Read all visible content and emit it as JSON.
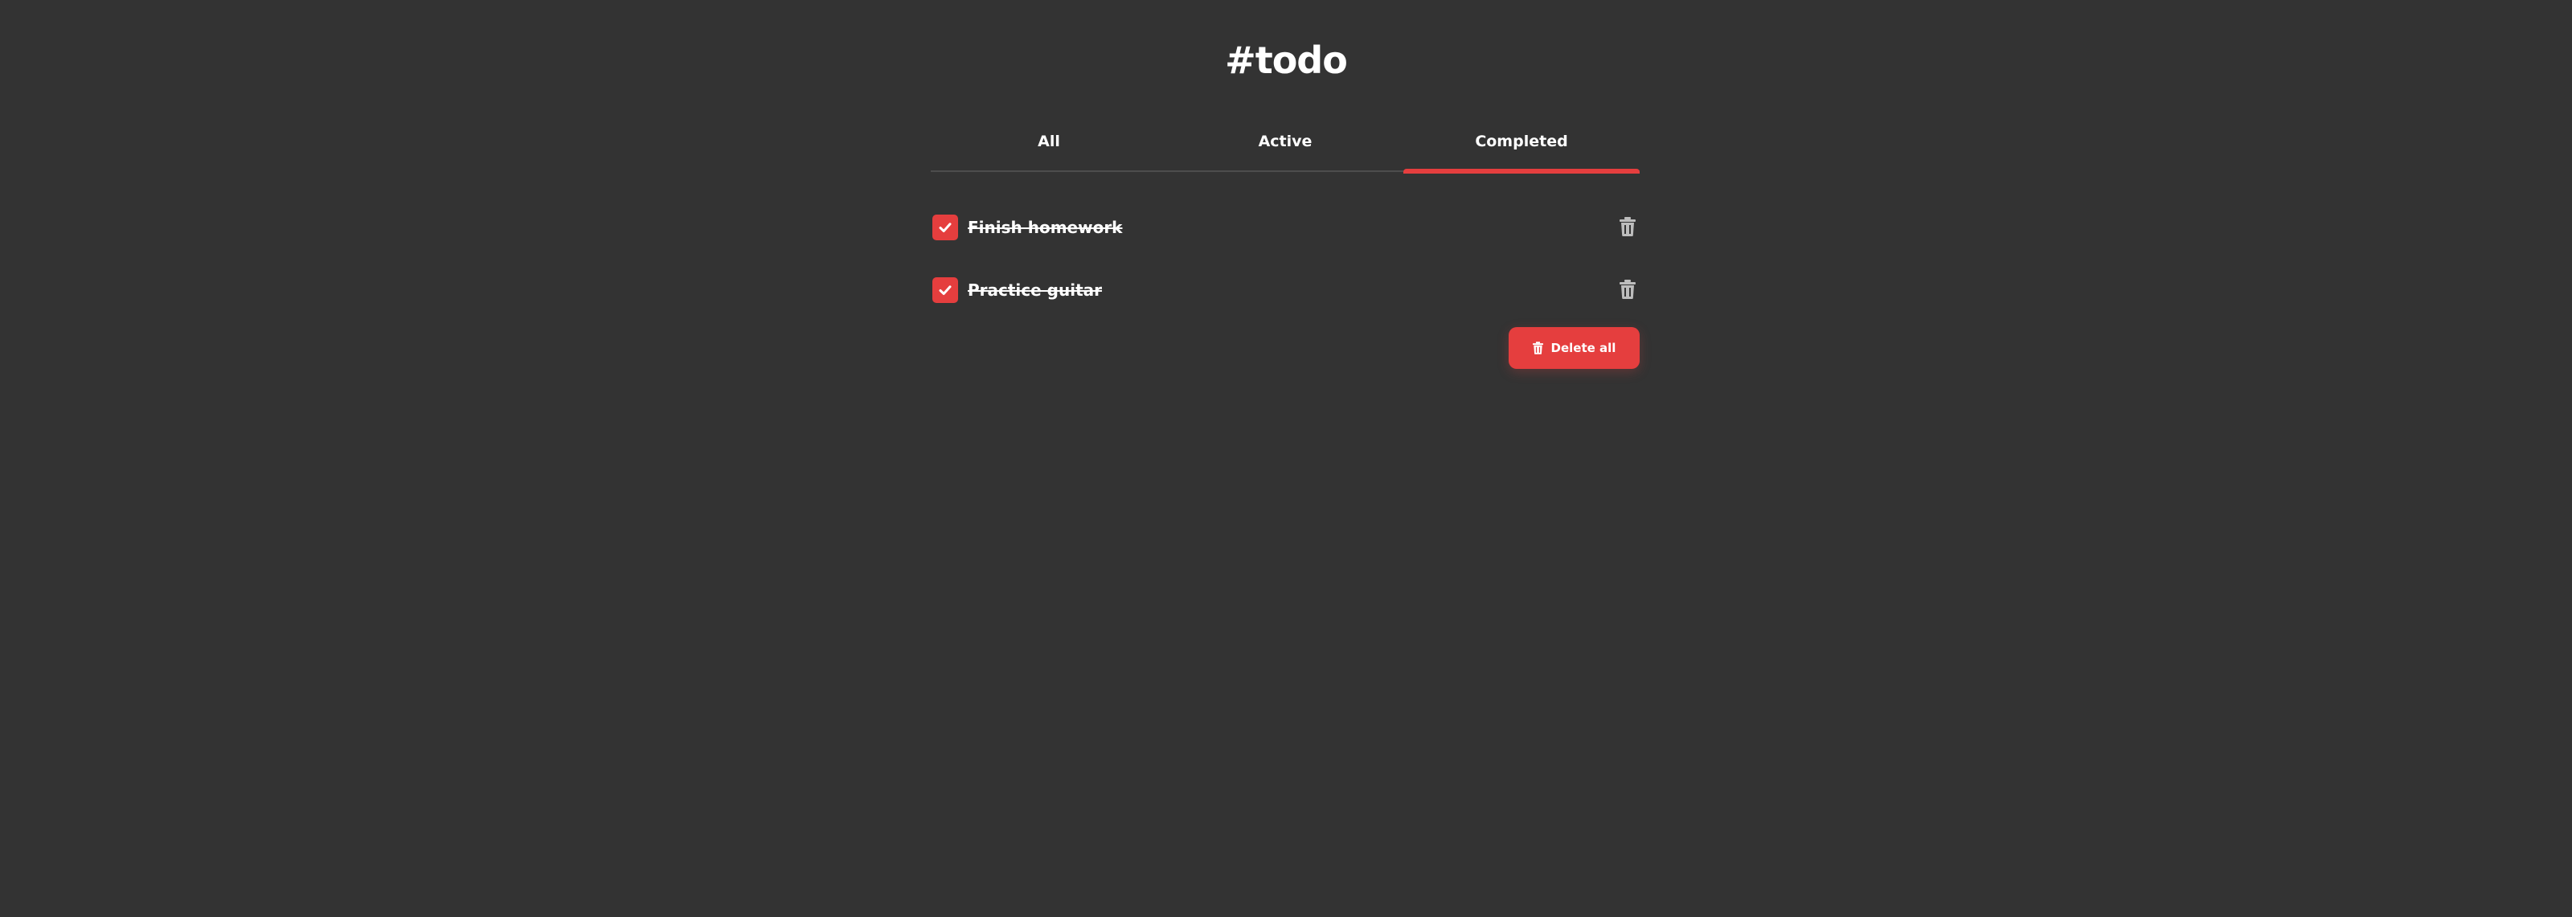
{
  "app": {
    "title": "#todo"
  },
  "tabs": [
    {
      "label": "All",
      "active": false
    },
    {
      "label": "Active",
      "active": false
    },
    {
      "label": "Completed",
      "active": true
    }
  ],
  "todos": [
    {
      "label": "Finish homework",
      "completed": true,
      "check_icon": "check-icon",
      "delete_icon": "trash-icon"
    },
    {
      "label": "Practice guitar",
      "completed": true,
      "check_icon": "check-icon",
      "delete_icon": "trash-icon"
    }
  ],
  "actions": {
    "delete_all_label": "Delete all",
    "delete_all_icon": "trash-icon"
  },
  "colors": {
    "background": "#333333",
    "accent": "#e53e3e",
    "text": "#ffffff",
    "icon_muted": "#bdbdbd",
    "divider": "#4d4d4d"
  }
}
